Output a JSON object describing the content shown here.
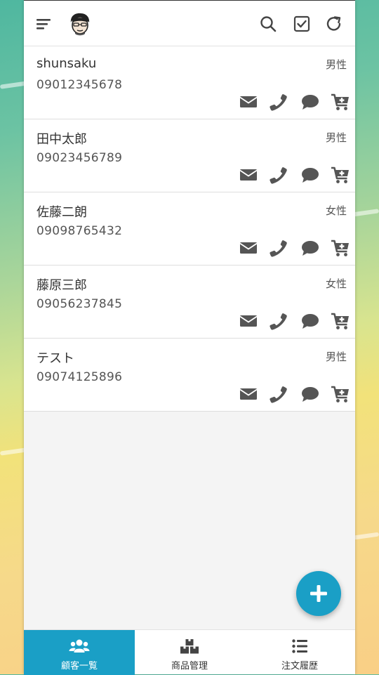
{
  "header": {
    "menu_icon": "menu-lines-icon",
    "avatar_icon": "avatar-face-icon",
    "search_icon": "search-icon",
    "check_icon": "checkbox-icon",
    "refresh_icon": "refresh-icon"
  },
  "customers": [
    {
      "name": "shunsaku",
      "phone": "09012345678",
      "gender": "男性"
    },
    {
      "name": "田中太郎",
      "phone": "09023456789",
      "gender": "男性"
    },
    {
      "name": "佐藤二朗",
      "phone": "09098765432",
      "gender": "女性"
    },
    {
      "name": "藤原三郎",
      "phone": "09056237845",
      "gender": "女性"
    },
    {
      "name": "テスト",
      "phone": "09074125896",
      "gender": "男性"
    }
  ],
  "actions": [
    "mail-icon",
    "phone-icon",
    "chat-icon",
    "cart-add-icon"
  ],
  "fab": {
    "icon": "plus-icon"
  },
  "tabs": [
    {
      "label": "顧客一覧",
      "icon": "users-icon",
      "active": true
    },
    {
      "label": "商品管理",
      "icon": "boxes-icon",
      "active": false
    },
    {
      "label": "注文履歴",
      "icon": "list-icon",
      "active": false
    }
  ],
  "colors": {
    "accent": "#1a9fc6",
    "icon": "#555555",
    "text": "#333333"
  }
}
